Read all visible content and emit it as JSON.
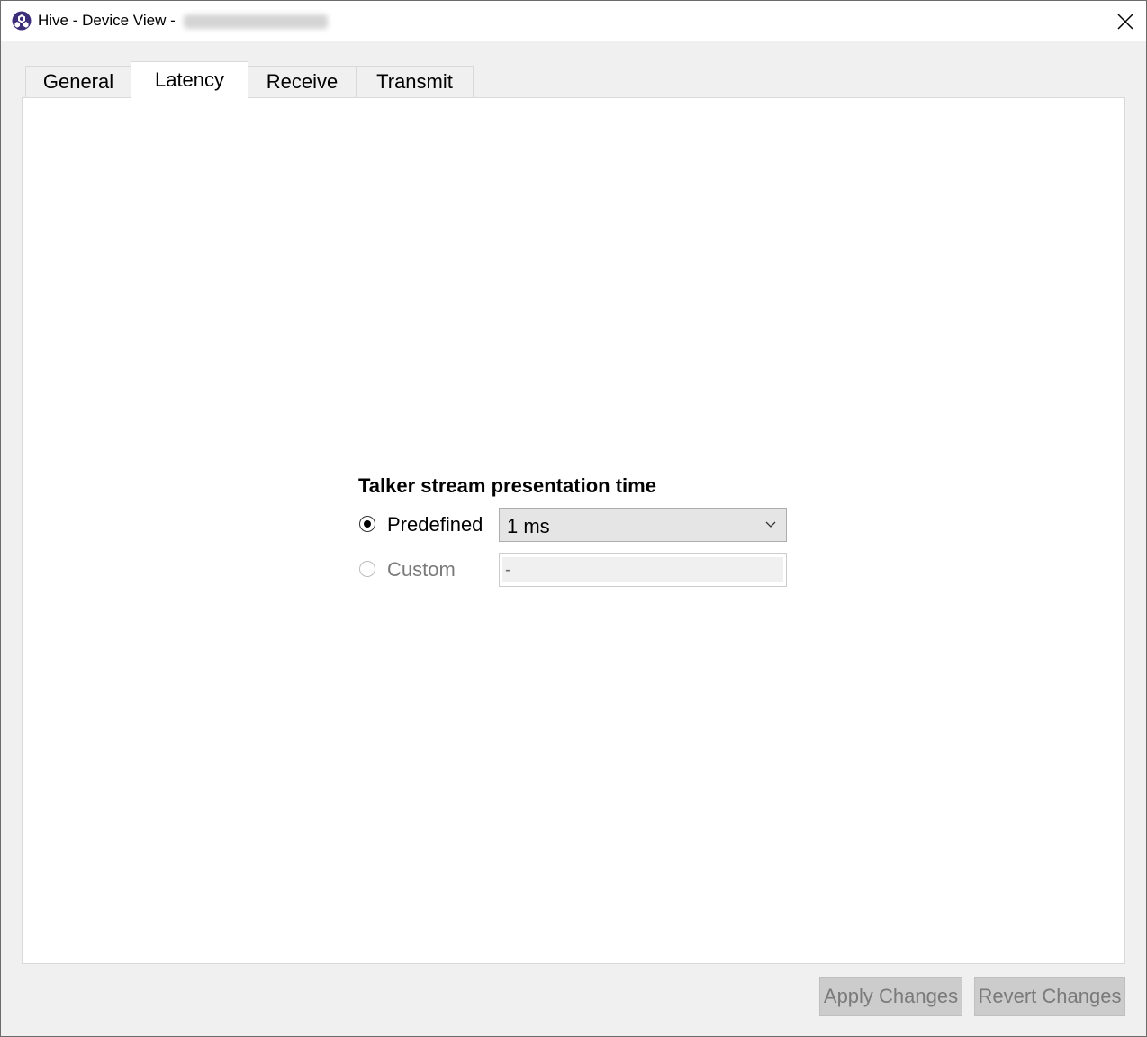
{
  "window": {
    "title": "Hive - Device View -",
    "colors": {
      "accent": "#3d2e7a",
      "tab_selected_bg": "#ffffff",
      "disabled_text": "#7a7a7a"
    }
  },
  "tabs": [
    {
      "label": "General",
      "selected": false
    },
    {
      "label": "Latency",
      "selected": true
    },
    {
      "label": "Receive",
      "selected": false
    },
    {
      "label": "Transmit",
      "selected": false
    }
  ],
  "latency": {
    "group_title": "Talker stream presentation time",
    "predefined": {
      "label": "Predefined",
      "checked": true,
      "selected_value": "1 ms"
    },
    "custom": {
      "label": "Custom",
      "checked": false,
      "enabled": false,
      "value": "-"
    }
  },
  "buttons": {
    "apply": "Apply Changes",
    "revert": "Revert Changes"
  },
  "icons": {
    "app": "hive-icon",
    "close": "close-icon",
    "dropdown": "chevron-down-icon"
  }
}
